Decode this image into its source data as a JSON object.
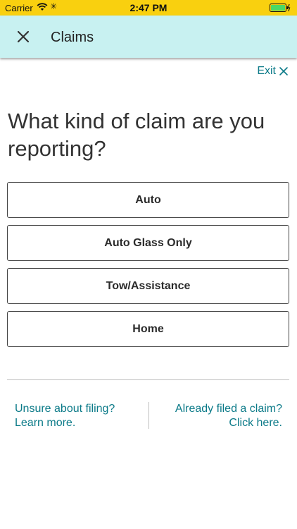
{
  "status_bar": {
    "carrier": "Carrier",
    "time": "2:47 PM",
    "wifi_icon": "wifi-icon",
    "activity_icon": "activity-spinner-icon",
    "battery_icon": "battery-charging-icon",
    "battery_color": "#4cd964"
  },
  "nav": {
    "title": "Claims",
    "close_icon": "close-icon",
    "background": "#c8f1f1"
  },
  "exit": {
    "label": "Exit",
    "icon": "close-icon"
  },
  "question": "What kind of claim are you reporting?",
  "options": [
    {
      "label": "Auto"
    },
    {
      "label": "Auto Glass Only"
    },
    {
      "label": "Tow/Assistance"
    },
    {
      "label": "Home"
    }
  ],
  "footer_links": {
    "left": {
      "line1": "Unsure about filing?",
      "line2": "Learn more."
    },
    "right": {
      "line1": "Already filed a claim?",
      "line2": "Click here."
    }
  },
  "colors": {
    "status_bar": "#f9d00f",
    "link": "#0b7a88"
  }
}
